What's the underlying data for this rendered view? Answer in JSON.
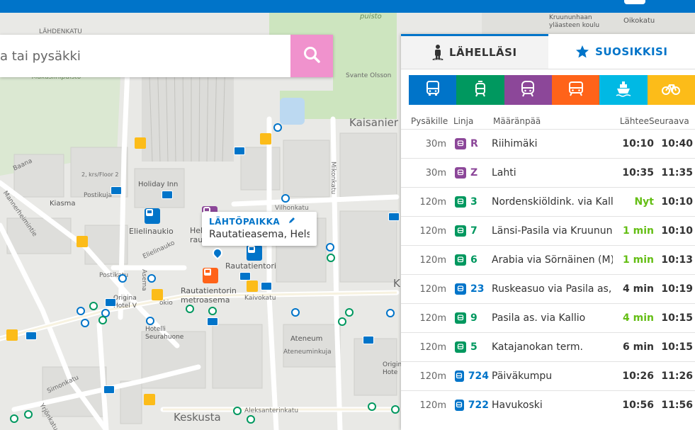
{
  "colors": {
    "topbar": "#0074c9",
    "bus": "#0074c9",
    "tram": "#00985f",
    "train": "#8c4799",
    "metro": "#ff6319",
    "ferry": "#00b9e4",
    "bike": "#fcbc19",
    "search_button": "#f092cd",
    "realtime": "#64be14"
  },
  "search": {
    "placeholder": "a tai pysäkki",
    "icon": "search-icon"
  },
  "map": {
    "labels": {
      "kaisaniemi": "Kaisanier",
      "keskusta": "Keskusta",
      "puisto": "puisto",
      "kruununhaka": "Kruununhaan yläasteen koulu",
      "oikokatu": "Oikokatu",
      "lahdenkatu": "LÄHDENKATU",
      "makasiinipuisto": "Makasiinipuisto",
      "svante": "Svante Olsson",
      "holiday_inn": "Holiday Inn",
      "kiasma": "Kiasma",
      "postikuja": "Postikuja",
      "postikatu": "Postikatu",
      "elielinaukio": "Elielinaukio",
      "elielinaukio_street": "Elielinauko",
      "rautatientori": "Rautatientori",
      "rautatientorin_metroasema": "Rautatientorin metroasema",
      "kaivokatu": "Kaivokatu",
      "vilhonkatu": "Vilhonkatu",
      "mikonkatu": "Mikonkatu",
      "ateneum": "Ateneum",
      "ateneuminkuja": "Ateneuminkuja",
      "hotelli_seurahuone": "Hotelli Seurahuone",
      "simonkatu": "Simonkatu",
      "yrjonkatu": "Yrjönkatu",
      "aleksanterinkatu": "Aleksanterinkatu",
      "mannerheimintie": "Mannerheimintie",
      "baana": "Baana",
      "floor": "2, krs/Floor 2",
      "original_hotel": "Origina Hotel V",
      "original_hotel2": "Original Hote",
      "aseman": "Asema",
      "okio": "okio",
      "hel_rautat": "Hel rautat",
      "kaisan": "Kaisan",
      "rautatieaseman": "Rautatieaseman",
      "k": "K"
    },
    "popup": {
      "title": "LÄHTÖPAIKKA",
      "address": "Rautatieasema, Helsinki"
    }
  },
  "panel": {
    "tabs": [
      {
        "label": "LÄHELLÄSI",
        "icon": "person-icon",
        "active": true
      },
      {
        "label": "SUOSIKKISI",
        "icon": "star-icon",
        "active": false
      }
    ],
    "modes": [
      {
        "name": "bus",
        "color": "#0074c9",
        "icon": "bus-icon"
      },
      {
        "name": "tram",
        "color": "#00985f",
        "icon": "tram-icon"
      },
      {
        "name": "train",
        "color": "#8c4799",
        "icon": "train-icon"
      },
      {
        "name": "metro",
        "color": "#ff6319",
        "icon": "metro-icon"
      },
      {
        "name": "ferry",
        "color": "#00b9e4",
        "icon": "ferry-icon"
      },
      {
        "name": "bike",
        "color": "#fcbc19",
        "icon": "bike-icon"
      }
    ],
    "headers": {
      "walk": "Pysäkille",
      "line": "Linja",
      "dest": "Määränpää",
      "dep": "Lähtee",
      "next": "Seuraava"
    },
    "rows": [
      {
        "walk": "30m",
        "mode": "train",
        "line": "R",
        "dest": "Riihimäki",
        "dep": "10:10",
        "realtime": false,
        "next": "10:40"
      },
      {
        "walk": "30m",
        "mode": "train",
        "line": "Z",
        "dest": "Lahti",
        "dep": "10:35",
        "realtime": false,
        "next": "11:35"
      },
      {
        "walk": "120m",
        "mode": "tram",
        "line": "3",
        "dest": "Nordenskiöldink. via Kallio",
        "dep": "Nyt",
        "realtime": true,
        "next": "10:10"
      },
      {
        "walk": "120m",
        "mode": "tram",
        "line": "7",
        "dest": "Länsi-Pasila via Kruununhaka",
        "dep": "1 min",
        "realtime": true,
        "next": "10:10"
      },
      {
        "walk": "120m",
        "mode": "tram",
        "line": "6",
        "dest": "Arabia via Sörnäinen (M)",
        "dep": "1 min",
        "realtime": true,
        "next": "10:13"
      },
      {
        "walk": "120m",
        "mode": "bus",
        "line": "23",
        "dest": "Ruskeasuo via Pasila as,",
        "dep": "4 min",
        "realtime": false,
        "next": "10:19"
      },
      {
        "walk": "120m",
        "mode": "tram",
        "line": "9",
        "dest": "Pasila as. via Kallio",
        "dep": "4 min",
        "realtime": true,
        "next": "10:15"
      },
      {
        "walk": "120m",
        "mode": "tram",
        "line": "5",
        "dest": "Katajanokan term.",
        "dep": "6 min",
        "realtime": false,
        "next": "10:15"
      },
      {
        "walk": "120m",
        "mode": "bus",
        "line": "724",
        "dest": "Päiväkumpu",
        "dep": "10:26",
        "realtime": false,
        "next": "11:26"
      },
      {
        "walk": "120m",
        "mode": "bus",
        "line": "722",
        "dest": "Havukoski",
        "dep": "10:56",
        "realtime": false,
        "next": "11:56"
      }
    ]
  }
}
